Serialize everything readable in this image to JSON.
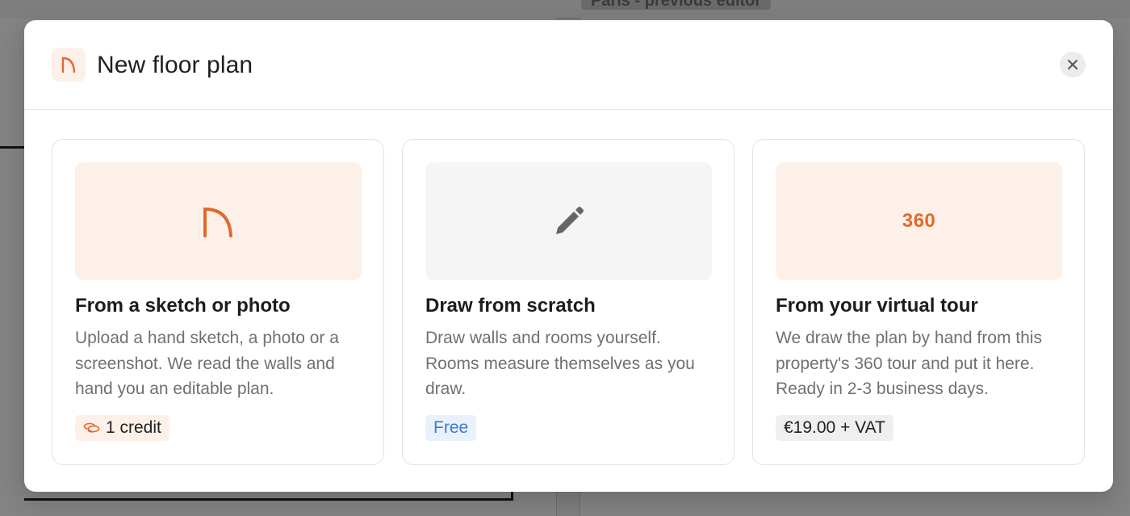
{
  "background": {
    "breadcrumb": "Paris - previous editor"
  },
  "modal": {
    "title": "New floor plan",
    "header_icon": "floor-plan-arc-icon",
    "close_icon": "close-icon"
  },
  "cards": [
    {
      "media_icon": "floor-plan-arc-icon",
      "title": "From a sketch or photo",
      "description": "Upload a hand sketch, a photo or a screenshot. We read the walls and hand you an editable plan.",
      "badge_icon": "coins-icon",
      "badge": "1 credit"
    },
    {
      "media_icon": "pencil-icon",
      "title": "Draw from scratch",
      "description": "Draw walls and rooms yourself. Rooms measure themselves as you draw.",
      "badge": "Free"
    },
    {
      "media_text": "360",
      "title": "From your virtual tour",
      "description": "We draw the plan by hand from this property's 360 tour and put it here. Ready in 2-3 business days.",
      "badge": "€19.00 + VAT"
    }
  ],
  "colors": {
    "accent": "#e06a2c",
    "accent_bg": "#fdf0e8",
    "free_text": "#3a7bd5",
    "free_bg": "#e8f1fc"
  }
}
